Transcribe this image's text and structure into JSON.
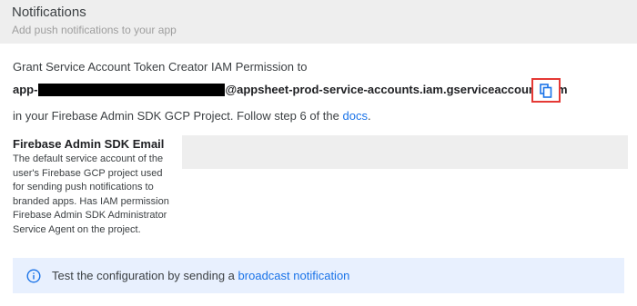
{
  "header": {
    "title": "Notifications",
    "subtitle": "Add push notifications to your app"
  },
  "permission": {
    "intro": "Grant Service Account Token Creator IAM Permission to",
    "account_prefix": "app-",
    "account_suffix": "@appsheet-prod-service-accounts.iam.gserviceaccount.com",
    "copy_icon": "copy-icon",
    "project_text": "in your Firebase Admin SDK GCP Project. Follow step 6 of the ",
    "docs_link": "docs",
    "period": "."
  },
  "firebase_field": {
    "label": "Firebase Admin SDK Email",
    "help": "The default service account of the user's Firebase GCP project used for sending push notifications to branded apps. Has IAM permission Firebase Admin SDK Administrator Service Agent on the project.",
    "value": ""
  },
  "info": {
    "icon": "info-icon",
    "text": "Test the configuration by sending a ",
    "link": "broadcast notification"
  },
  "colors": {
    "accent": "#1a73e8",
    "highlight_border": "#e53935",
    "info_bg": "#e8f0fe"
  }
}
